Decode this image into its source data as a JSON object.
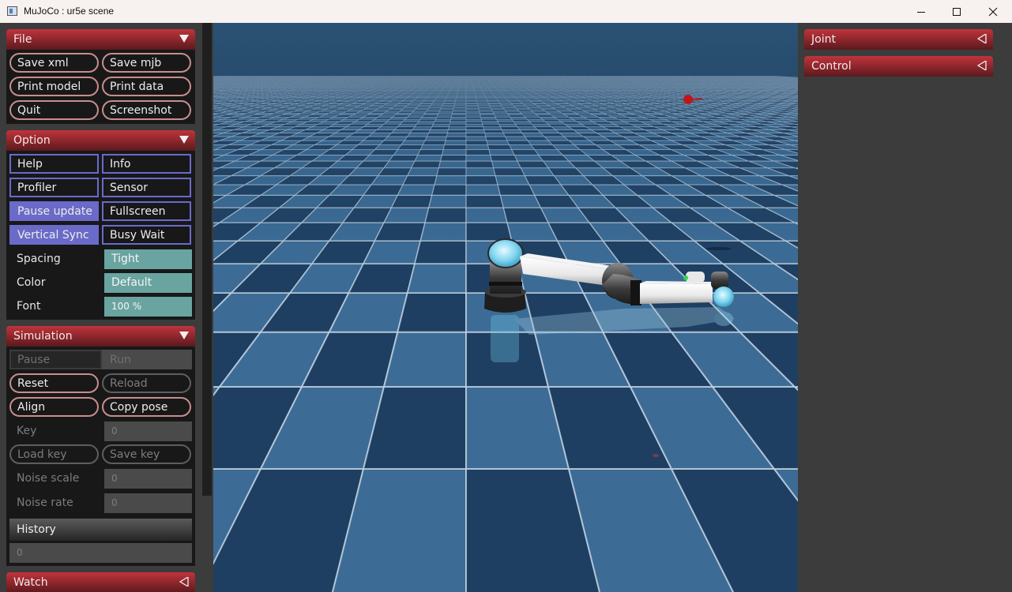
{
  "window": {
    "title": "MuJoCo : ur5e scene",
    "icon": "app-window-icon",
    "controls": [
      "minimize-icon",
      "maximize-icon",
      "close-icon"
    ]
  },
  "left_panel": {
    "file": {
      "header": "File",
      "buttons": [
        "Save xml",
        "Save mjb",
        "Print model",
        "Print data",
        "Quit",
        "Screenshot"
      ]
    },
    "option": {
      "header": "Option",
      "toggles": [
        {
          "label": "Help",
          "on": false
        },
        {
          "label": "Info",
          "on": false
        },
        {
          "label": "Profiler",
          "on": false
        },
        {
          "label": "Sensor",
          "on": false
        },
        {
          "label": "Pause update",
          "on": true
        },
        {
          "label": "Fullscreen",
          "on": false
        },
        {
          "label": "Vertical Sync",
          "on": true
        },
        {
          "label": "Busy Wait",
          "on": false
        }
      ],
      "settings": [
        {
          "label": "Spacing",
          "value": "Tight"
        },
        {
          "label": "Color",
          "value": "Default"
        },
        {
          "label": "Font",
          "value": "100 %"
        }
      ]
    },
    "simulation": {
      "header": "Simulation",
      "pause": "Pause",
      "run": "Run",
      "reset": "Reset",
      "reload": "Reload",
      "align": "Align",
      "copy_pose": "Copy pose",
      "key_label": "Key",
      "key_value": "0",
      "load_key": "Load key",
      "save_key": "Save key",
      "noise_scale_label": "Noise scale",
      "noise_scale_value": "0",
      "noise_rate_label": "Noise rate",
      "noise_rate_value": "0",
      "history_label": "History",
      "history_value": "0"
    },
    "watch": {
      "header": "Watch"
    }
  },
  "right_panel": {
    "joint": {
      "header": "Joint"
    },
    "control": {
      "header": "Control"
    }
  },
  "colors": {
    "header_red": "#c1343c",
    "toggle_on": "#6a6ac8",
    "teal_value": "#6aa4a0",
    "floor_dark": "#1e3f62",
    "floor_light": "#3c6c96"
  }
}
